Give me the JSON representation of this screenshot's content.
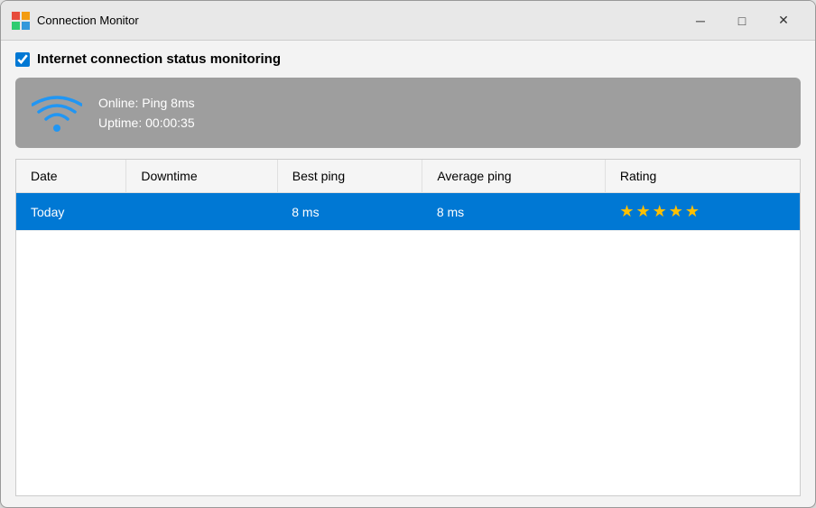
{
  "window": {
    "title": "Connection Monitor",
    "icon_label": "app-icon"
  },
  "titlebar": {
    "minimize_label": "─",
    "maximize_label": "□",
    "close_label": "✕"
  },
  "checkbox": {
    "label": "Internet connection status monitoring",
    "checked": true
  },
  "status_panel": {
    "online_label": "Online: Ping 8ms",
    "uptime_label": "Uptime: 00:00:35"
  },
  "table": {
    "columns": [
      "Date",
      "Downtime",
      "Best ping",
      "Average ping",
      "Rating"
    ],
    "rows": [
      {
        "date": "Today",
        "downtime": "",
        "best_ping": "8 ms",
        "average_ping": "8 ms",
        "rating": "★★★★★",
        "selected": true
      }
    ]
  }
}
